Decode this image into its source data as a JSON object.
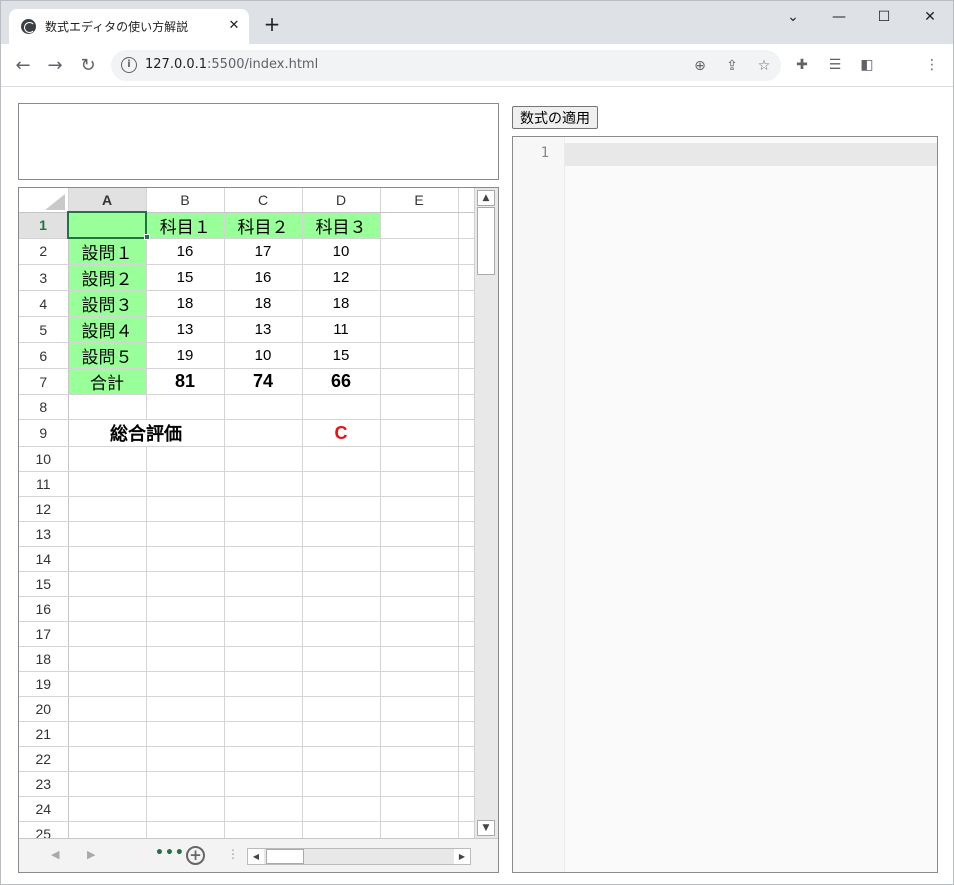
{
  "browser": {
    "tab_title": "数式エディタの使い方解説",
    "url_host": "127.0.0.1",
    "url_rest": ":5500/index.html"
  },
  "page": {
    "apply_button": "数式の適用",
    "editor_line_number": "1"
  },
  "sheet": {
    "columns": [
      "A",
      "B",
      "C",
      "D",
      "E"
    ],
    "rows": [
      {
        "n": "1",
        "cells": [
          "",
          "科目１",
          "科目２",
          "科目３",
          ""
        ]
      },
      {
        "n": "2",
        "cells": [
          "設問１",
          "16",
          "17",
          "10",
          ""
        ]
      },
      {
        "n": "3",
        "cells": [
          "設問２",
          "15",
          "16",
          "12",
          ""
        ]
      },
      {
        "n": "4",
        "cells": [
          "設問３",
          "18",
          "18",
          "18",
          ""
        ]
      },
      {
        "n": "5",
        "cells": [
          "設問４",
          "13",
          "13",
          "11",
          ""
        ]
      },
      {
        "n": "6",
        "cells": [
          "設問５",
          "19",
          "10",
          "15",
          ""
        ]
      },
      {
        "n": "7",
        "cells": [
          "合計",
          "81",
          "74",
          "66",
          ""
        ]
      },
      {
        "n": "8",
        "cells": [
          "",
          "",
          "",
          "",
          ""
        ]
      },
      {
        "n": "9",
        "cells": [
          "総合評価",
          "",
          "",
          "C",
          ""
        ]
      },
      {
        "n": "10",
        "cells": [
          "",
          "",
          "",
          "",
          ""
        ]
      },
      {
        "n": "11",
        "cells": [
          "",
          "",
          "",
          "",
          ""
        ]
      },
      {
        "n": "12",
        "cells": [
          "",
          "",
          "",
          "",
          ""
        ]
      },
      {
        "n": "13",
        "cells": [
          "",
          "",
          "",
          "",
          ""
        ]
      },
      {
        "n": "14",
        "cells": [
          "",
          "",
          "",
          "",
          ""
        ]
      },
      {
        "n": "15",
        "cells": [
          "",
          "",
          "",
          "",
          ""
        ]
      },
      {
        "n": "16",
        "cells": [
          "",
          "",
          "",
          "",
          ""
        ]
      },
      {
        "n": "17",
        "cells": [
          "",
          "",
          "",
          "",
          ""
        ]
      },
      {
        "n": "18",
        "cells": [
          "",
          "",
          "",
          "",
          ""
        ]
      },
      {
        "n": "19",
        "cells": [
          "",
          "",
          "",
          "",
          ""
        ]
      },
      {
        "n": "20",
        "cells": [
          "",
          "",
          "",
          "",
          ""
        ]
      },
      {
        "n": "21",
        "cells": [
          "",
          "",
          "",
          "",
          ""
        ]
      },
      {
        "n": "22",
        "cells": [
          "",
          "",
          "",
          "",
          ""
        ]
      },
      {
        "n": "23",
        "cells": [
          "",
          "",
          "",
          "",
          ""
        ]
      },
      {
        "n": "24",
        "cells": [
          "",
          "",
          "",
          "",
          ""
        ]
      },
      {
        "n": "25",
        "cells": [
          "",
          "",
          "",
          "",
          ""
        ]
      }
    ],
    "highlight_color": "#99ff99",
    "accent_color": "#217346",
    "grade_color": "#e81010"
  }
}
